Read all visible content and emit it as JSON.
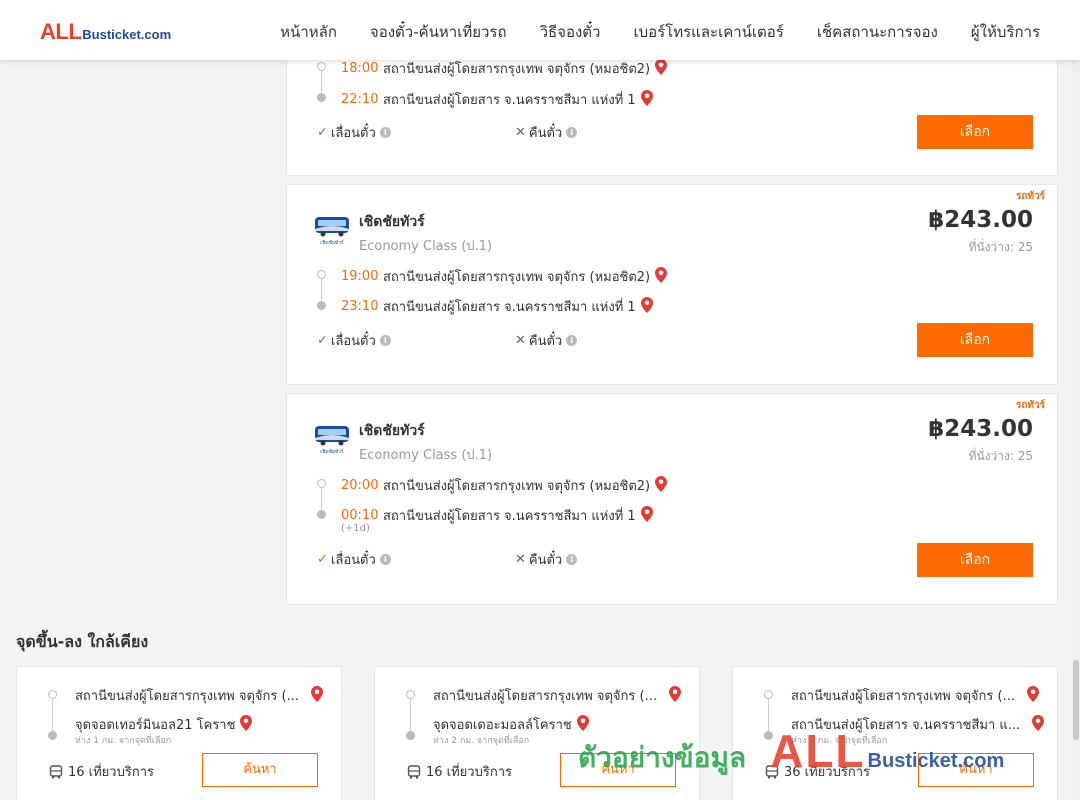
{
  "brand": {
    "logo_main": "ALL",
    "logo_rest": "Busticket.com"
  },
  "nav": [
    "หน้าหลัก",
    "จองตั๋ว-ค้นหาเที่ยวรถ",
    "วิธีจองตั๋ว",
    "เบอร์โทรและเคาน์เตอร์",
    "เช็คสถานะการจอง",
    "ผู้ให้บริการ"
  ],
  "trips": [
    {
      "depart_time": "18:00",
      "depart_station": "สถานีขนส่งผู้โดยสารกรุงเทพ จตุจักร (หมอชิต2)",
      "arrive_time": "22:10",
      "arrive_station": "สถานีขนส่งผู้โดยสาร จ.นครราชสีมา แห่งที่ 1",
      "postpone": "เลื่อนตั๋ว",
      "refund": "คืนตั๋ว",
      "select": "เลือก"
    },
    {
      "badge": "รถทัวร์",
      "operator": "เชิดชัยทัวร์",
      "class": "Economy Class (ป.1)",
      "price": "฿243.00",
      "seats": "ที่นั่งว่าง: 25",
      "depart_time": "19:00",
      "depart_station": "สถานีขนส่งผู้โดยสารกรุงเทพ จตุจักร (หมอชิต2)",
      "arrive_time": "23:10",
      "arrive_station": "สถานีขนส่งผู้โดยสาร จ.นครราชสีมา แห่งที่ 1",
      "postpone": "เลื่อนตั๋ว",
      "refund": "คืนตั๋ว",
      "select": "เลือก"
    },
    {
      "badge": "รถทัวร์",
      "operator": "เชิดชัยทัวร์",
      "class": "Economy Class (ป.1)",
      "price": "฿243.00",
      "seats": "ที่นั่งว่าง: 25",
      "depart_time": "20:00",
      "depart_station": "สถานีขนส่งผู้โดยสารกรุงเทพ จตุจักร (หมอชิต2)",
      "arrive_time": "00:10",
      "arrive_station": "สถานีขนส่งผู้โดยสาร จ.นครราชสีมา แห่งที่ 1",
      "next_day": "(+1d)",
      "postpone": "เลื่อนตั๋ว",
      "refund": "คืนตั๋ว",
      "select": "เลือก"
    }
  ],
  "nearby": {
    "title": "จุดขึ้น-ลง ใกล้เคียง",
    "cards": [
      {
        "from": "สถานีขนส่งผู้โดยสารกรุงเทพ จตุจักร (...",
        "to": "จุดจอดเทอร์มินอล21 โคราช",
        "distance": "ห่าง 1 กม. จากจุดที่เลือก",
        "trips": "16 เที่ยวบริการ",
        "search": "ค้นหา"
      },
      {
        "from": "สถานีขนส่งผู้โดยสารกรุงเทพ จตุจักร (...",
        "to": "จุดจอดเดอะมอลล์โคราช",
        "distance": "ห่าง 2 กม. จากจุดที่เลือก",
        "trips": "16 เที่ยวบริการ",
        "search": "ค้นหา"
      },
      {
        "from": "สถานีขนส่งผู้โดยสารกรุงเทพ จตุจักร (...",
        "to": "สถานีขนส่งผู้โดยสาร จ.นครราชสีมา แ...",
        "distance": "ห่าง 2 กม. จากจุดที่เลือก",
        "trips": "36 เที่ยวบริการ",
        "search": "ค้นหา"
      }
    ]
  },
  "watermark": {
    "thai": "ตัวอย่างข้อมูล",
    "all": "ALL",
    "busticket": "Busticket.com"
  },
  "colors": {
    "accent": "#ff6a00",
    "time": "#f26b0f",
    "check": "#2fa84f",
    "pin": "#e53935",
    "logo_red": "#e8402a",
    "logo_blue": "#1f4b99",
    "watermark_green": "#27a74a"
  }
}
